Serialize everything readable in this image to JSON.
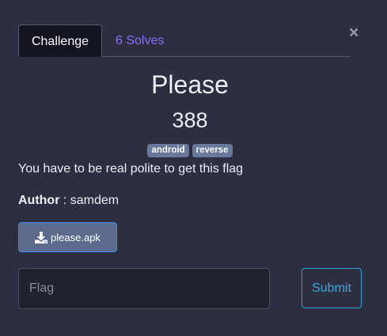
{
  "tabs": {
    "challenge_label": "Challenge",
    "solves_label": "6 Solves"
  },
  "close_icon": "×",
  "challenge": {
    "title": "Please",
    "points": "388",
    "tags": [
      "android",
      "reverse"
    ],
    "description": "You have to be real polite to get this flag",
    "author_label": "Author",
    "author_separator": " : ",
    "author_name": "samdem"
  },
  "file": {
    "label": "please.apk",
    "icon": "download-icon"
  },
  "flag_input": {
    "value": "",
    "placeholder": "Flag"
  },
  "submit_label": "Submit",
  "colors": {
    "background": "#2e2e42",
    "tab_active_bg": "#14141f",
    "solves_link": "#8b6cf7",
    "tag_bg": "#68789a",
    "download_bg": "#5c6b8c",
    "download_border": "#3f86e6",
    "submit": "#3aa8d8"
  }
}
